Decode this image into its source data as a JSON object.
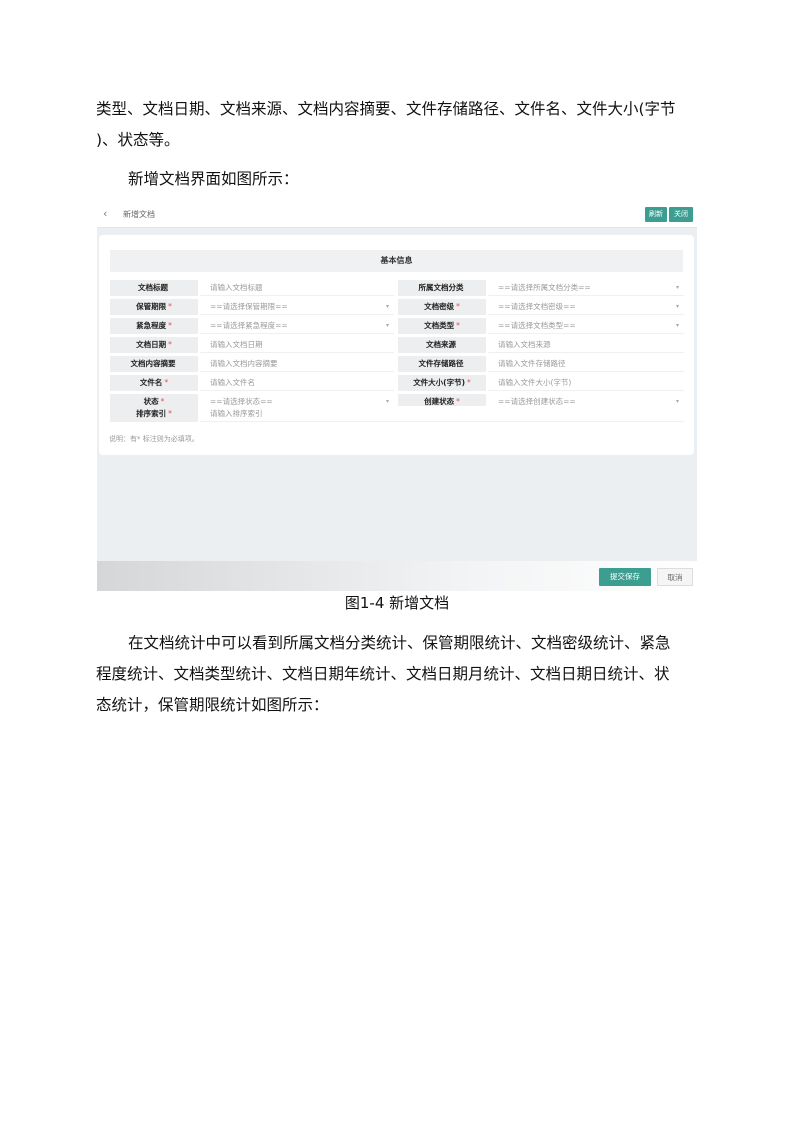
{
  "doc": {
    "para1_line1": "类型、文档日期、文档来源、文档内容摘要、文件存储路径、文件名、文件大小(字节",
    "para1_line2": ")、状态等。",
    "para2": "新增文档界面如图所示：",
    "caption": "图1-4 新增文档",
    "para3_line1": "在文档统计中可以看到所属文档分类统计、保管期限统计、文档密级统计、紧急",
    "para3_line2": "程度统计、文档类型统计、文档日期年统计、文档日期月统计、文档日期日统计、状",
    "para3_line3": "态统计，保管期限统计如图所示："
  },
  "ui": {
    "back_icon": "chevron-left-icon",
    "page_title": "新增文档",
    "refresh_label": "刷新",
    "close_label": "关闭",
    "section_title": "基本信息",
    "rows": [
      {
        "left_label": "文档标题",
        "left_req": "",
        "left_value": "请输入文档标题",
        "left_caret": "",
        "right_label": "所属文档分类",
        "right_req": "",
        "right_value": "==请选择所属文档分类==",
        "right_caret": "▾"
      },
      {
        "left_label": "保管期限",
        "left_req": "*",
        "left_value": "==请选择保管期限==",
        "left_caret": "▾",
        "right_label": "文档密级",
        "right_req": "*",
        "right_value": "==请选择文档密级==",
        "right_caret": "▾"
      },
      {
        "left_label": "紧急程度",
        "left_req": "*",
        "left_value": "==请选择紧急程度==",
        "left_caret": "▾",
        "right_label": "文档类型",
        "right_req": "*",
        "right_value": "==请选择文档类型==",
        "right_caret": "▾"
      },
      {
        "left_label": "文档日期",
        "left_req": "*",
        "left_value": "请输入文档日期",
        "left_caret": "",
        "right_label": "文档来源",
        "right_req": "",
        "right_value": "请输入文档来源",
        "right_caret": ""
      },
      {
        "left_label": "文档内容摘要",
        "left_req": "",
        "left_value": "请输入文档内容摘要",
        "left_caret": "",
        "right_label": "文件存储路径",
        "right_req": "",
        "right_value": "请输入文件存储路径",
        "right_caret": ""
      },
      {
        "left_label": "文件名",
        "left_req": "*",
        "left_value": "请输入文件名",
        "left_caret": "",
        "right_label": "文件大小(字节)",
        "right_req": "*",
        "right_value": "请输入文件大小(字节)",
        "right_caret": ""
      },
      {
        "left_label": "状态",
        "left_req": "*",
        "left_value": "==请选择状态==",
        "left_caret": "▾",
        "right_label": "创建状态",
        "right_req": "*",
        "right_value": "==请选择创建状态==",
        "right_caret": "▾"
      }
    ],
    "sort_label": "排序索引",
    "sort_req": "*",
    "sort_value": "请输入排序索引",
    "note": "说明：有* 标注则为必填项。",
    "save_label": "提交保存",
    "cancel_label": "取消"
  }
}
